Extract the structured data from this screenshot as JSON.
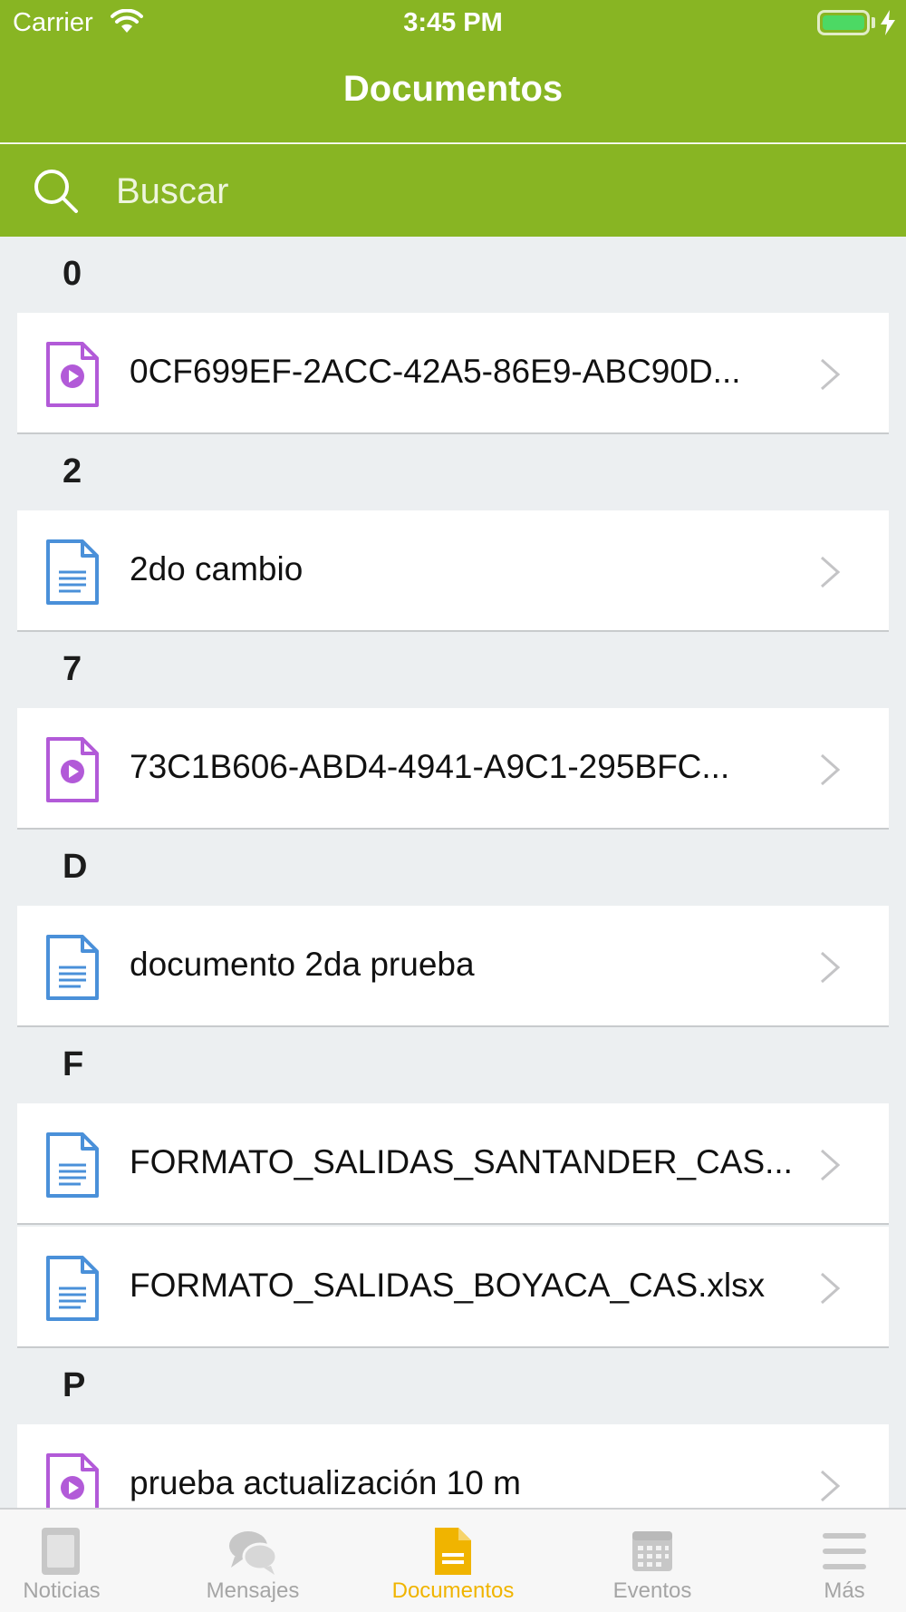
{
  "status_bar": {
    "carrier": "Carrier",
    "time": "3:45 PM"
  },
  "header": {
    "title": "Documentos"
  },
  "search": {
    "placeholder": "Buscar"
  },
  "sections": [
    {
      "letter": "0",
      "items": [
        {
          "label": "0CF699EF-2ACC-42A5-86E9-ABC90D...",
          "icon": "video-file-icon"
        }
      ]
    },
    {
      "letter": "2",
      "items": [
        {
          "label": "2do cambio",
          "icon": "document-file-icon"
        }
      ]
    },
    {
      "letter": "7",
      "items": [
        {
          "label": "73C1B606-ABD4-4941-A9C1-295BFC...",
          "icon": "video-file-icon"
        }
      ]
    },
    {
      "letter": "D",
      "items": [
        {
          "label": "documento 2da prueba",
          "icon": "document-file-icon"
        }
      ]
    },
    {
      "letter": "F",
      "items": [
        {
          "label": "FORMATO_SALIDAS_SANTANDER_CAS....",
          "icon": "document-file-icon"
        },
        {
          "label": "FORMATO_SALIDAS_BOYACA_CAS.xlsx",
          "icon": "document-file-icon"
        }
      ]
    },
    {
      "letter": "P",
      "items": [
        {
          "label": "prueba actualización 10 m",
          "icon": "video-file-icon"
        }
      ]
    }
  ],
  "tabs": [
    {
      "label": "Noticias",
      "icon": "newspaper-icon",
      "active": false
    },
    {
      "label": "Mensajes",
      "icon": "chat-bubbles-icon",
      "active": false
    },
    {
      "label": "Documentos",
      "icon": "document-icon",
      "active": true
    },
    {
      "label": "Eventos",
      "icon": "calendar-icon",
      "active": false
    },
    {
      "label": "Más",
      "icon": "menu-icon",
      "active": false
    }
  ],
  "colors": {
    "brand_green": "#88b523",
    "active_tab": "#f0b400",
    "inactive_tab": "#a5a5a5",
    "video_icon": "#b25ad8",
    "document_icon": "#4a90d9",
    "background": "#eceff1"
  }
}
